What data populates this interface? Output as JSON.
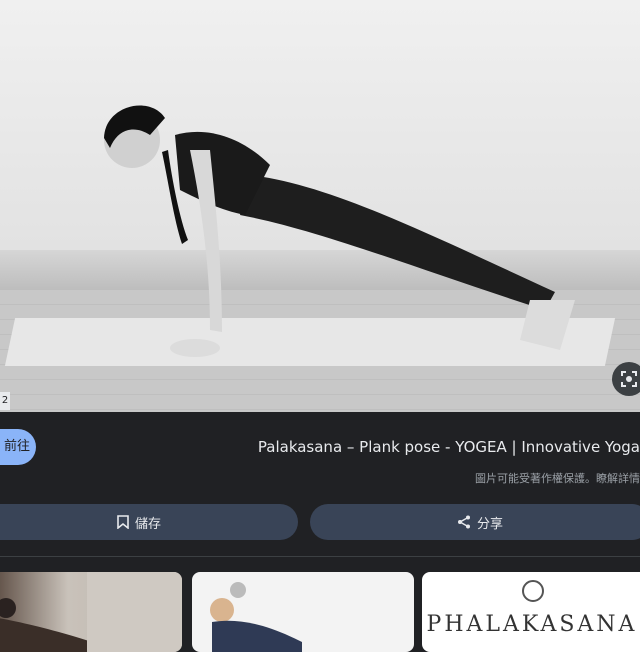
{
  "hero": {
    "badge": "2",
    "lens_icon": "lens-icon"
  },
  "result": {
    "visit_label": "前往",
    "title": "Palakasana – Plank pose - YOGEA | Innovative Yoga",
    "notice": "圖片可能受著作權保護。瞭解詳情"
  },
  "actions": {
    "share_label": "分享",
    "share_icon": "share-icon",
    "save_label": "儲存",
    "save_icon": "bookmark-icon"
  },
  "related": {
    "thumb3_text": "PHALAKASANA"
  },
  "colors": {
    "background": "#202124",
    "accent": "#8ab4f8",
    "button": "#394457"
  }
}
